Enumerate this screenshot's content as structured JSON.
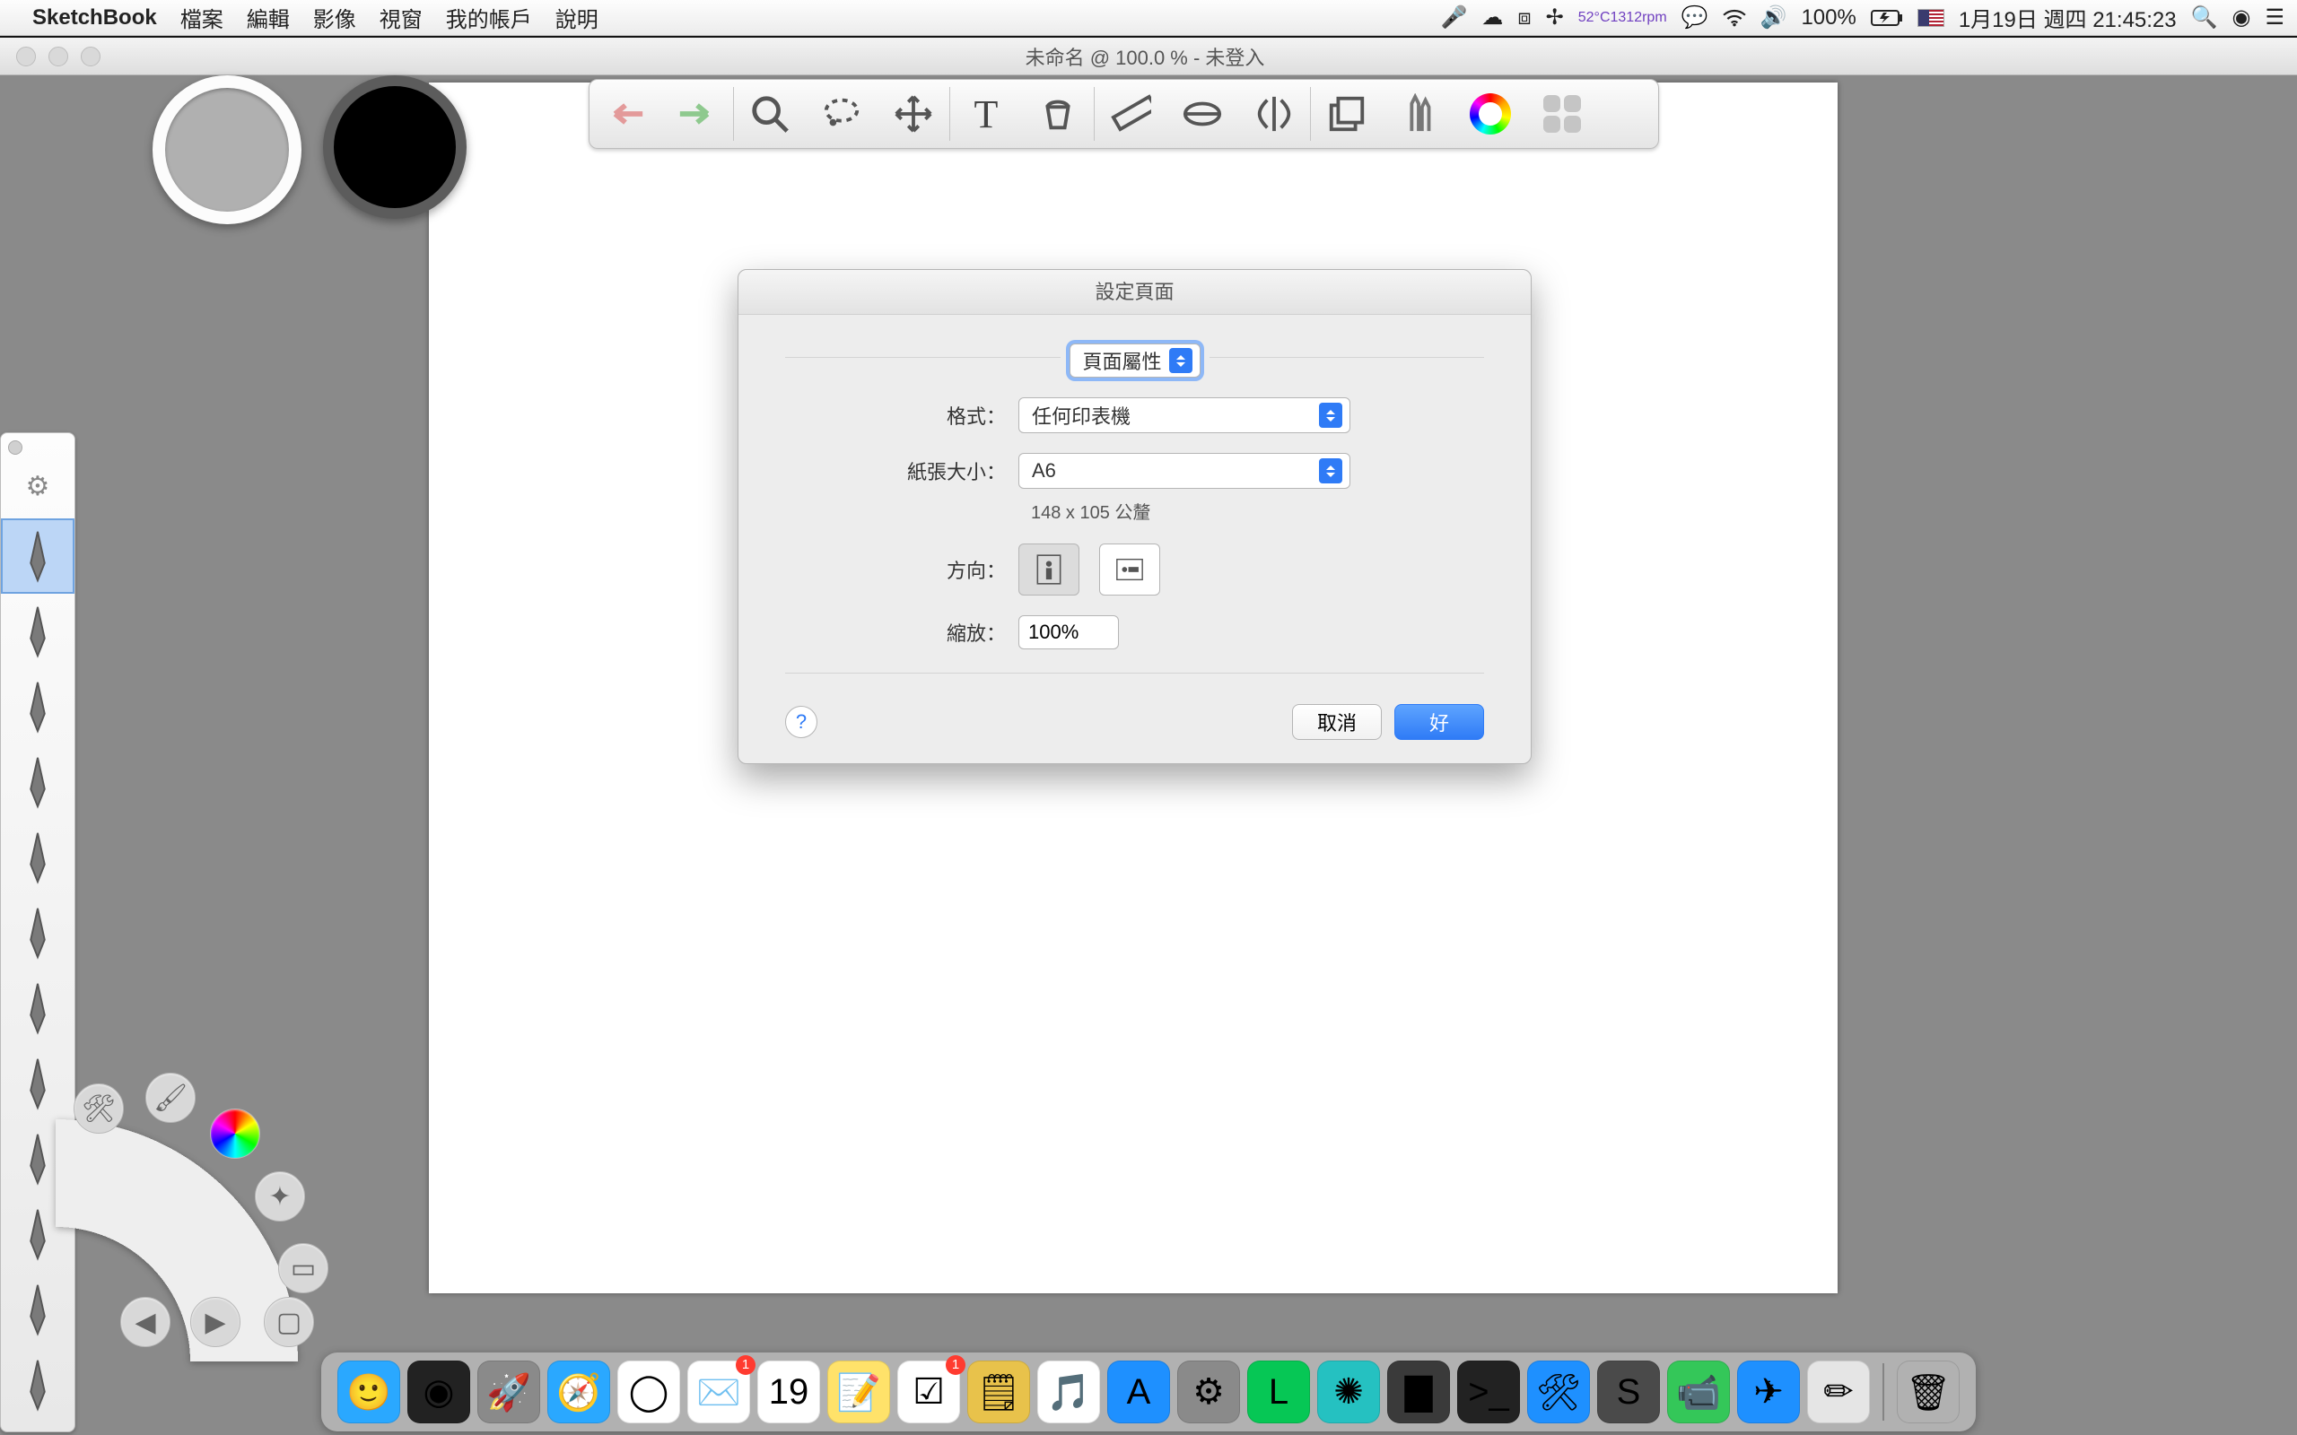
{
  "menubar": {
    "app_name": "SketchBook",
    "items": [
      "檔案",
      "編輯",
      "影像",
      "視窗",
      "我的帳戶",
      "說明"
    ],
    "status": {
      "temp_line1": "52°C",
      "temp_line2": "1312rpm",
      "battery_pct": "100%",
      "clock": "1月19日 週四  21:45:23"
    }
  },
  "window": {
    "title": "未命名 @ 100.0 % - 未登入"
  },
  "toolbar_icons": [
    "undo-icon",
    "redo-icon",
    "zoom-icon",
    "lasso-icon",
    "move-icon",
    "text-icon",
    "bucket-icon",
    "ruler-icon",
    "ellipse-guide-icon",
    "symmetry-icon",
    "layers-icon",
    "brush-group-icon",
    "color-wheel-icon",
    "ui-toggle-icon"
  ],
  "brush_palette": [
    "pencil",
    "airbrush",
    "marker",
    "felt",
    "paintbrush",
    "chisel",
    "ballpoint",
    "inking",
    "flat",
    "soft",
    "hard",
    "technical"
  ],
  "dialog": {
    "title": "設定頁面",
    "mode_label": "頁面屬性",
    "rows": {
      "format_label": "格式：",
      "format_value": "任何印表機",
      "paper_label": "紙張大小：",
      "paper_value": "A6",
      "paper_dims": "148 x 105 公釐",
      "orient_label": "方向：",
      "scale_label": "縮放：",
      "scale_value": "100%"
    },
    "buttons": {
      "help": "?",
      "cancel": "取消",
      "ok": "好"
    }
  },
  "dock_apps": [
    {
      "name": "finder",
      "bg": "#2aa8ff",
      "glyph": "🙂"
    },
    {
      "name": "siri",
      "bg": "#222",
      "glyph": "◉"
    },
    {
      "name": "launchpad",
      "bg": "#8a8a8a",
      "glyph": "🚀"
    },
    {
      "name": "safari",
      "bg": "#2aa8ff",
      "glyph": "🧭"
    },
    {
      "name": "chrome",
      "bg": "#fff",
      "glyph": "◯"
    },
    {
      "name": "mail",
      "bg": "#fff",
      "glyph": "✉️",
      "badge": "1"
    },
    {
      "name": "calendar",
      "bg": "#fff",
      "glyph": "19"
    },
    {
      "name": "notes",
      "bg": "#ffe26a",
      "glyph": "📝"
    },
    {
      "name": "reminders",
      "bg": "#fff",
      "glyph": "☑︎",
      "badge": "1"
    },
    {
      "name": "stickies",
      "bg": "#e8c24b",
      "glyph": "🗒"
    },
    {
      "name": "itunes",
      "bg": "#fff",
      "glyph": "🎵"
    },
    {
      "name": "appstore",
      "bg": "#1e90ff",
      "glyph": "A"
    },
    {
      "name": "settings",
      "bg": "#8a8a8a",
      "glyph": "⚙︎"
    },
    {
      "name": "line",
      "bg": "#06c755",
      "glyph": "L"
    },
    {
      "name": "asterisk",
      "bg": "#25c1c1",
      "glyph": "✺"
    },
    {
      "name": "activity",
      "bg": "#3a3a3a",
      "glyph": "▇"
    },
    {
      "name": "terminal",
      "bg": "#222",
      "glyph": ">_"
    },
    {
      "name": "xcode",
      "bg": "#1e90ff",
      "glyph": "🛠"
    },
    {
      "name": "sublime",
      "bg": "#4a4a4a",
      "glyph": "S"
    },
    {
      "name": "facetime",
      "bg": "#34c759",
      "glyph": "📹"
    },
    {
      "name": "messenger",
      "bg": "#1e90ff",
      "glyph": "✈︎"
    },
    {
      "name": "sketchbook",
      "bg": "#e5e5e5",
      "glyph": "✏︎"
    }
  ],
  "dock_trash": {
    "name": "trash",
    "bg": "transparent",
    "glyph": "🗑"
  }
}
